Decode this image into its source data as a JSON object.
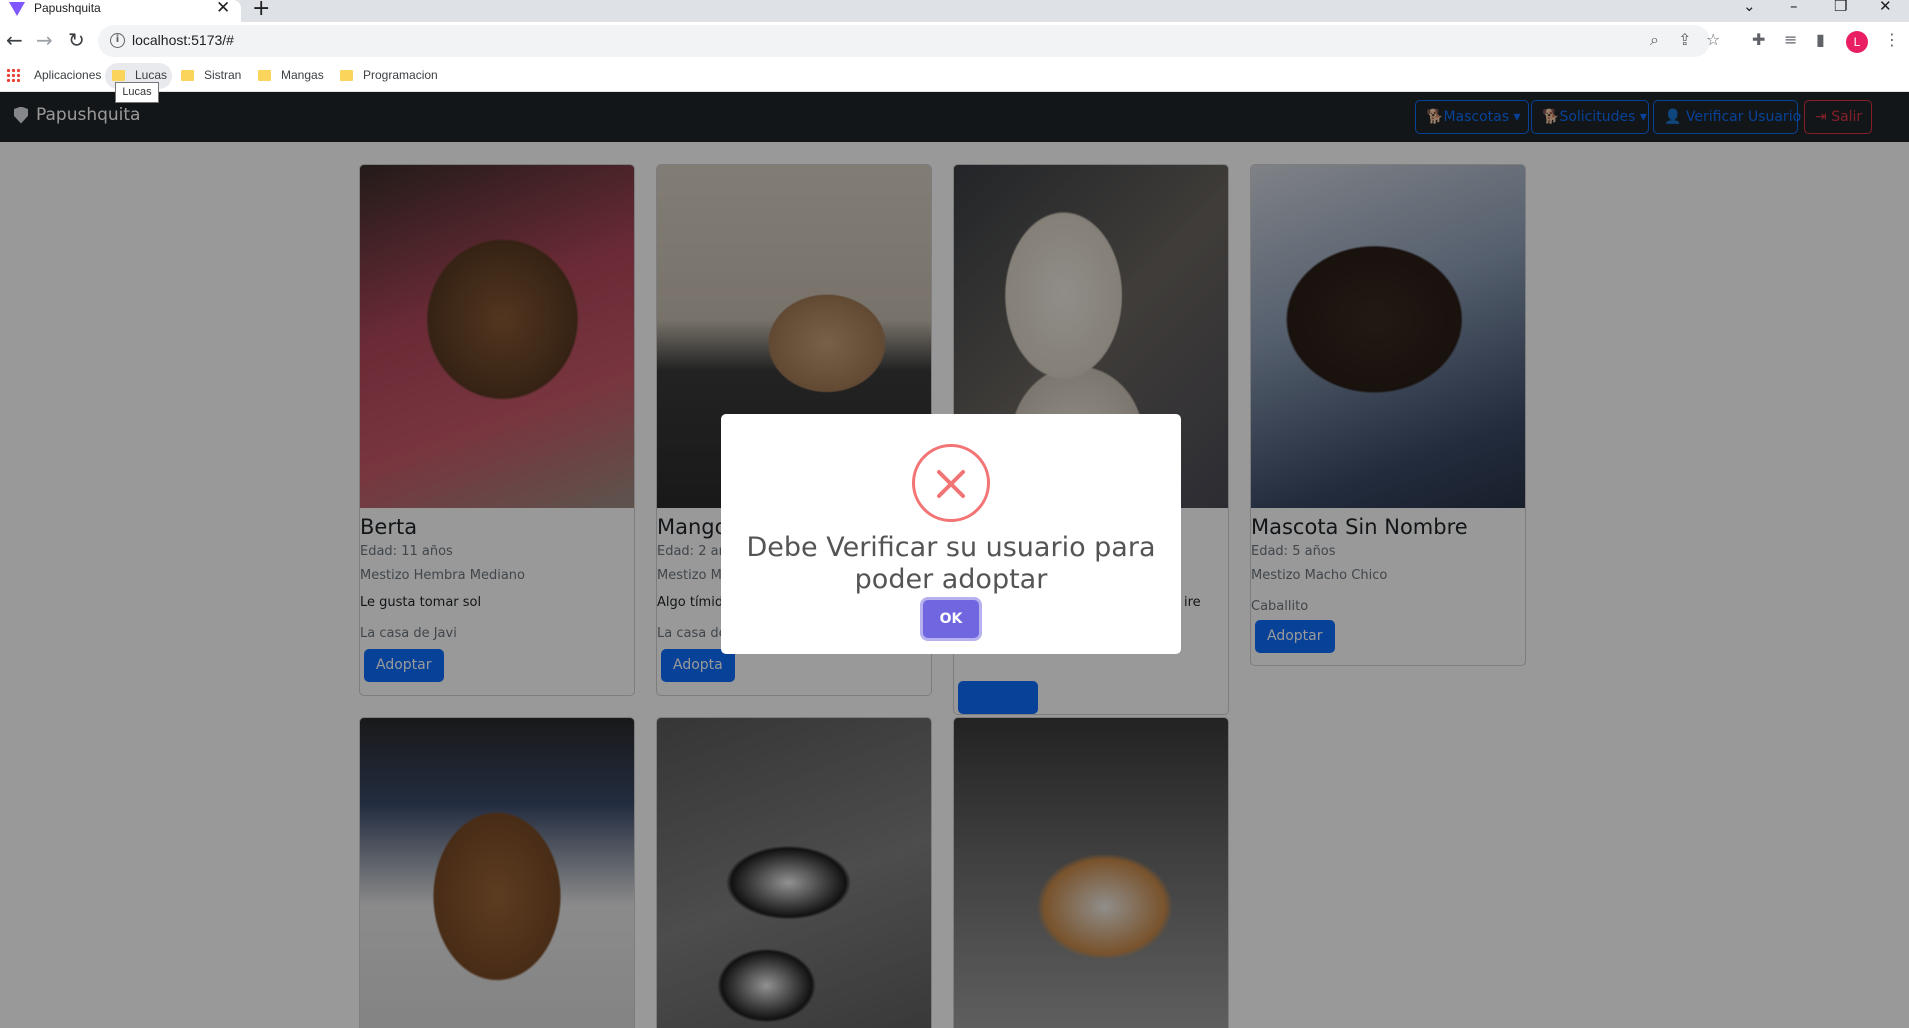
{
  "browser": {
    "tab_title": "Papushquita",
    "tab_close": "✕",
    "new_tab": "+",
    "url": "localhost:5173/#",
    "profile_initial": "L",
    "bookmarks": [
      "Aplicaciones",
      "Lucas",
      "Sistran",
      "Mangas",
      "Programacion"
    ],
    "tooltip": "Lucas"
  },
  "navbar": {
    "brand": "Papushquita",
    "mascotas": "Mascotas",
    "solicitudes": "Solicitudes",
    "verificar": "Verificar Usuario",
    "salir": "Salir"
  },
  "cards": [
    {
      "name": "Berta",
      "age": "Edad: 11 años",
      "type": "Mestizo Hembra Mediano",
      "desc": "Le gusta tomar sol",
      "home": "La casa de Javi",
      "button": "Adoptar"
    },
    {
      "name": "Mango",
      "age": "Edad: 2 añ",
      "type": "Mestizo M",
      "desc": "Algo tímid",
      "home": "La casa de",
      "button": "Adopta"
    },
    {
      "name": "",
      "age": "",
      "type": "",
      "desc": "ire",
      "home": "",
      "button": ""
    },
    {
      "name": "Mascota Sin Nombre",
      "age": "Edad: 5 años",
      "type": "Mestizo Macho Chico",
      "desc": "Caballito",
      "home": "",
      "button": "Adoptar"
    }
  ],
  "modal": {
    "message": "Debe Verificar su usuario para poder adoptar",
    "ok": "OK"
  }
}
